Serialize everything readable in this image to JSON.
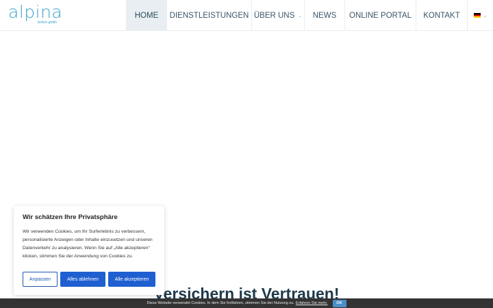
{
  "header": {
    "logo": {
      "word": "alpina",
      "tagline": "broker gmbh"
    },
    "nav": [
      {
        "label": "HOME",
        "active": true
      },
      {
        "label": "DIENSTLEISTUNGEN"
      },
      {
        "label": "ÜBER UNS",
        "has_submenu": true
      },
      {
        "label": "NEWS"
      },
      {
        "label": "ONLINE PORTAL"
      },
      {
        "label": "KONTAKT"
      }
    ],
    "language": {
      "flag": "de-flag-icon"
    }
  },
  "hero": {
    "title": "Versichern ist Vertrauen!"
  },
  "consent": {
    "title": "Wir schätzen Ihre Privatsphäre",
    "text": "Wir verwenden Cookies, um Ihr Surferlebnis zu verbessern, personalisierte Anzeigen oder Inhalte einzusetzen und unseren Datenverkehr zu analysieren. Wenn Sie auf „Alle akzeptieren“ klicken, stimmen Sie der Anwendung von Cookies zu.",
    "buttons": {
      "customize": "Anpassen",
      "reject": "Alles ablehnen",
      "accept": "Alle akzeptieren"
    }
  },
  "cookiebar": {
    "text": "Diese Website verwendet Cookies. In dem Sie fortfahren, stimmen Sie der Nutzung zu.",
    "link": "Erfahren Sie mehr.",
    "ok": "OK"
  }
}
